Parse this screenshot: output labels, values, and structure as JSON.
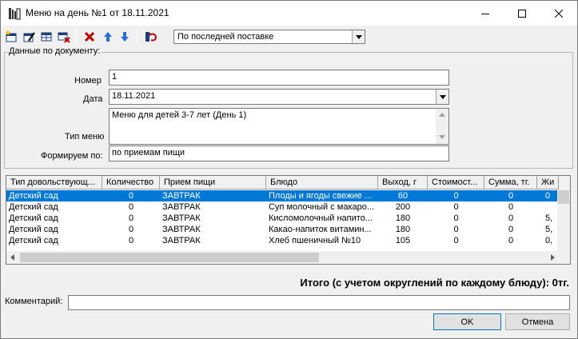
{
  "window": {
    "title": "Меню на день №1 от 18.11.2021"
  },
  "toolbar": {
    "combo_value": "По последней поставке"
  },
  "document": {
    "group_title": "Данные по документу:",
    "number_label": "Номер",
    "number_value": "1",
    "date_label": "Дата",
    "date_value": "18.11.2021",
    "menu_type_label": "Тип меню",
    "menu_type_value": "Меню для детей 3-7 лет (День 1)",
    "form_by_label": "Формируем по:",
    "form_by_value": "по приемам пищи"
  },
  "grid": {
    "columns": [
      "Тип довольствующ...",
      "Количество",
      "Прием пищи",
      "Блюдо",
      "Выход, г",
      "Стоимост...",
      "Сумма, тг.",
      "Жи"
    ],
    "rows": [
      [
        "Детский сад",
        "0",
        "ЗАВТРАК",
        "Плоды и ягоды свежие ...",
        "60",
        "0",
        "0",
        "0"
      ],
      [
        "Детский сад",
        "0",
        "ЗАВТРАК",
        "Суп молочный с макаро...",
        "200",
        "0",
        "0",
        ""
      ],
      [
        "Детский сад",
        "0",
        "ЗАВТРАК",
        "Кисломолочный напито...",
        "180",
        "0",
        "0",
        "5,"
      ],
      [
        "Детский сад",
        "0",
        "ЗАВТРАК",
        "Какао-напиток витамин...",
        "180",
        "0",
        "0",
        "5,"
      ],
      [
        "Детский сад",
        "0",
        "ЗАВТРАК",
        "Хлеб пшеничный №10",
        "105",
        "0",
        "0",
        "0,"
      ]
    ]
  },
  "footer": {
    "total": "Итого (с учетом округлений по каждому блюду): 0тг.",
    "comment_label": "Комментарий:",
    "comment_value": "",
    "ok_label": "OK",
    "cancel_label": "Отмена"
  }
}
